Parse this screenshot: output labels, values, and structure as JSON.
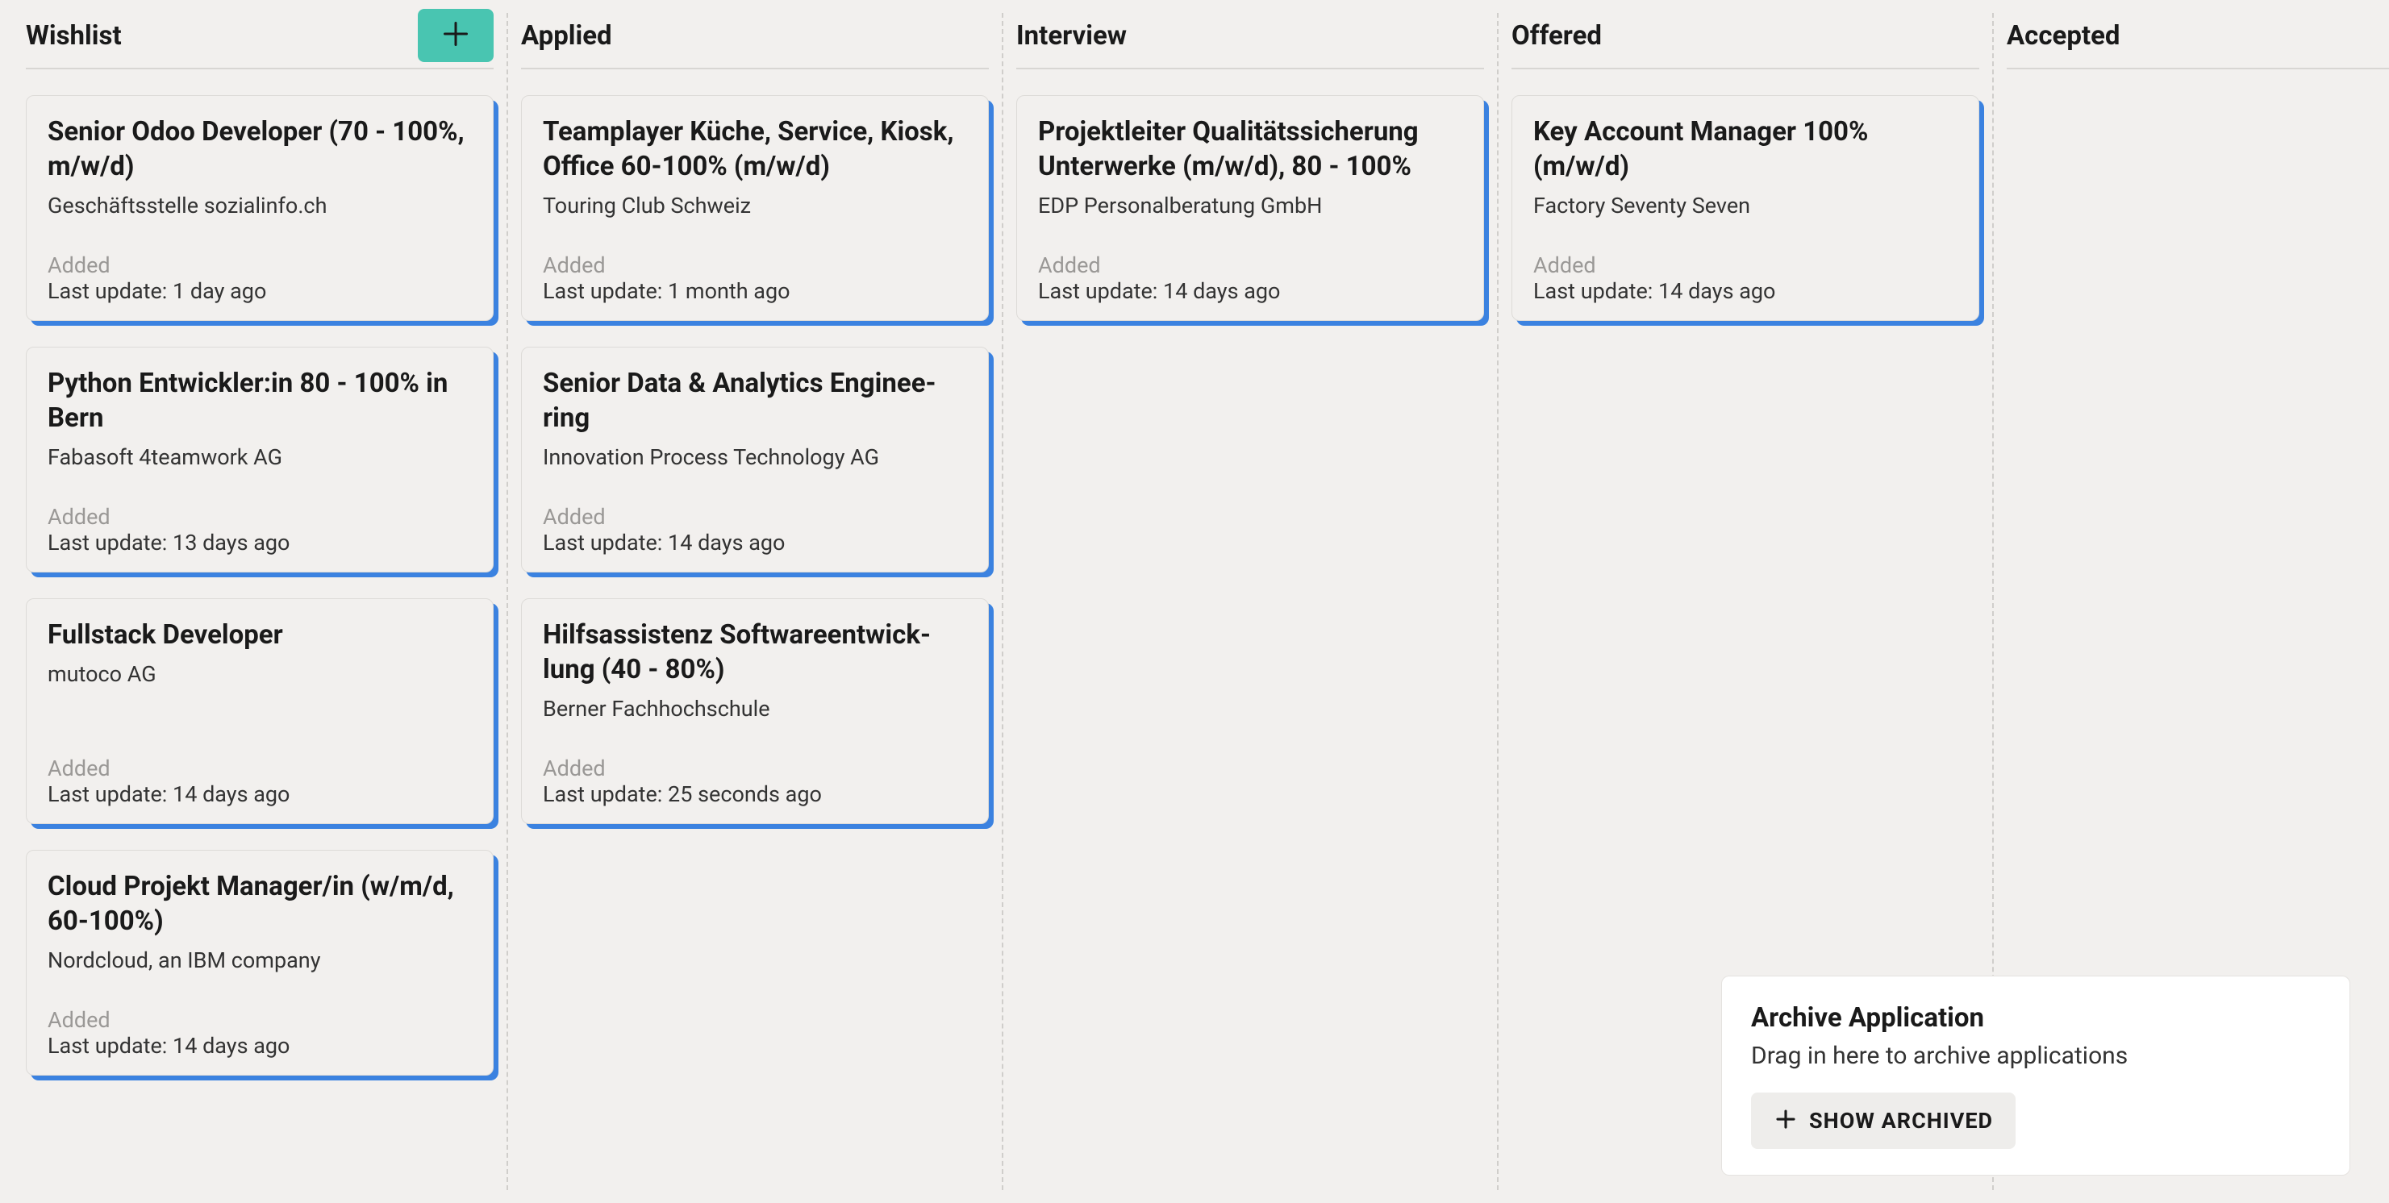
{
  "columns": [
    {
      "id": "wishlist",
      "title": "Wishlist",
      "has_add": true,
      "cards": [
        {
          "title": "Senior Odoo Developer (70 - 100%, m/w/d)",
          "company": "Geschäftsstelle sozialinfo.ch",
          "added": "Added",
          "updated": "Last update: 1 day ago"
        },
        {
          "title": "Python Entwickler:in 80 - 100% in Bern",
          "company": "Fabasoft 4teamwork AG",
          "added": "Added",
          "updated": "Last update: 13 days ago"
        },
        {
          "title": "Fullstack Developer",
          "company": "mutoco AG",
          "added": "Added",
          "updated": "Last update: 14 days ago"
        },
        {
          "title": "Cloud Projekt Manager/in (w/m/d, 60-100%)",
          "company": "Nordcloud, an IBM company",
          "added": "Added",
          "updated": "Last update: 14 days ago"
        }
      ]
    },
    {
      "id": "applied",
      "title": "Applied",
      "has_add": false,
      "cards": [
        {
          "title": "Teamplayer Küche, Service, Ki­osk, Office 60-100% (m/w/d)",
          "company": "Touring Club Schweiz",
          "added": "Added",
          "updated": "Last update: 1 month ago"
        },
        {
          "title": "Senior Data & Analytics Enginee­ring",
          "company": "Innovation Process Technology AG",
          "added": "Added",
          "updated": "Last update: 14 days ago"
        },
        {
          "title": "Hilfsassistenz Softwareentwick­lung (40 - 80%)",
          "company": "Berner Fachhochschule",
          "added": "Added",
          "updated": "Last update: 25 seconds ago"
        }
      ]
    },
    {
      "id": "interview",
      "title": "Interview",
      "has_add": false,
      "cards": [
        {
          "title": "Projektleiter Qualitätssicherung Unterwerke (m/w/d), 80 - 100%",
          "company": "EDP Personalberatung GmbH",
          "added": "Added",
          "updated": "Last update: 14 days ago"
        }
      ]
    },
    {
      "id": "offered",
      "title": "Offered",
      "has_add": false,
      "cards": [
        {
          "title": "Key Account Manager 100% (m/w/d)",
          "company": "Factory Seventy Seven",
          "added": "Added",
          "updated": "Last update: 14 days ago"
        }
      ]
    },
    {
      "id": "accepted",
      "title": "Accepted",
      "has_add": false,
      "cards": []
    }
  ],
  "archive": {
    "title": "Archive Application",
    "hint": "Drag in here to archive applications",
    "show_btn": "SHOW ARCHIVED"
  }
}
